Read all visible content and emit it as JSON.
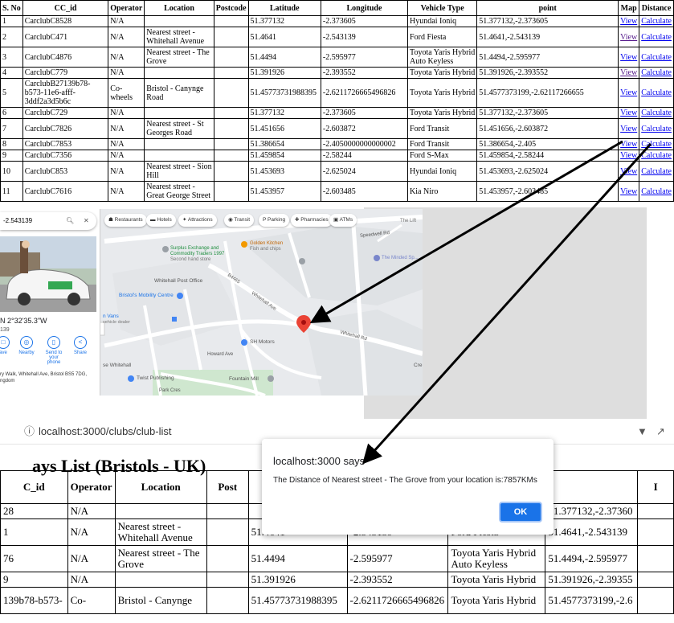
{
  "top_table": {
    "headers": [
      "S. No",
      "CC_id",
      "Operator",
      "Location",
      "Postcode",
      "Latitude",
      "Longitude",
      "Vehicle Type",
      "point",
      "Map",
      "Distance"
    ],
    "rows": [
      {
        "sno": "1",
        "cc_id": "CarclubC8528",
        "operator": "N/A",
        "location": "",
        "postcode": "",
        "lat": "51.377132",
        "lon": "-2.373605",
        "vehicle": "Hyundai Ioniq",
        "point": "51.377132,-2.373605",
        "map": "View",
        "distance": "Calculate"
      },
      {
        "sno": "2",
        "cc_id": "CarclubC471",
        "operator": "N/A",
        "location": "Nearest street - Whitehall Avenue",
        "postcode": "",
        "lat": "51.4641",
        "lon": "-2.543139",
        "vehicle": "Ford Fiesta",
        "point": "51.4641,-2.543139",
        "map": "View",
        "distance": "Calculate"
      },
      {
        "sno": "3",
        "cc_id": "CarclubC4876",
        "operator": "N/A",
        "location": "Nearest street - The Grove",
        "postcode": "",
        "lat": "51.4494",
        "lon": "-2.595977",
        "vehicle": "Toyota Yaris Hybrid Auto Keyless",
        "point": "51.4494,-2.595977",
        "map": "View",
        "distance": "Calculate"
      },
      {
        "sno": "4",
        "cc_id": "CarclubC779",
        "operator": "N/A",
        "location": "",
        "postcode": "",
        "lat": "51.391926",
        "lon": "-2.393552",
        "vehicle": "Toyota Yaris Hybrid",
        "point": "51.391926,-2.393552",
        "map": "View",
        "distance": "Calculate"
      },
      {
        "sno": "5",
        "cc_id": "CarclubB27139b78-b573-11e6-afff-3ddf2a3d5b6c",
        "operator": "Co-wheels",
        "location": "Bristol - Canynge Road",
        "postcode": "",
        "lat": "51.45773731988395",
        "lon": "-2.6211726665496826",
        "vehicle": "Toyota Yaris Hybrid",
        "point": "51.4577373199,-2.62117266655",
        "map": "View",
        "distance": "Calculate"
      },
      {
        "sno": "6",
        "cc_id": "CarclubC729",
        "operator": "N/A",
        "location": "",
        "postcode": "",
        "lat": "51.377132",
        "lon": "-2.373605",
        "vehicle": "Toyota Yaris Hybrid",
        "point": "51.377132,-2.373605",
        "map": "View",
        "distance": "Calculate"
      },
      {
        "sno": "7",
        "cc_id": "CarclubC7826",
        "operator": "N/A",
        "location": "Nearest street - St Georges Road",
        "postcode": "",
        "lat": "51.451656",
        "lon": "-2.603872",
        "vehicle": "Ford Transit",
        "point": "51.451656,-2.603872",
        "map": "View",
        "distance": "Calculate"
      },
      {
        "sno": "8",
        "cc_id": "CarclubC7853",
        "operator": "N/A",
        "location": "",
        "postcode": "",
        "lat": "51.386654",
        "lon": "-2.4050000000000002",
        "vehicle": "Ford Transit",
        "point": "51.386654,-2.405",
        "map": "View",
        "distance": "Calculate"
      },
      {
        "sno": "9",
        "cc_id": "CarclubC7356",
        "operator": "N/A",
        "location": "",
        "postcode": "",
        "lat": "51.459854",
        "lon": "-2.58244",
        "vehicle": "Ford S-Max",
        "point": "51.459854,-2.58244",
        "map": "View",
        "distance": "Calculate"
      },
      {
        "sno": "10",
        "cc_id": "CarclubC853",
        "operator": "N/A",
        "location": "Nearest street - Sion Hill",
        "postcode": "",
        "lat": "51.453693",
        "lon": "-2.625024",
        "vehicle": "Hyundai Ioniq",
        "point": "51.453693,-2.625024",
        "map": "View",
        "distance": "Calculate"
      },
      {
        "sno": "11",
        "cc_id": "CarclubC7616",
        "operator": "N/A",
        "location": "Nearest street - Great George Street",
        "postcode": "",
        "lat": "51.453957",
        "lon": "-2.603485",
        "vehicle": "Kia Niro",
        "point": "51.453957,-2.603485",
        "map": "View",
        "distance": "Calculate"
      }
    ]
  },
  "map": {
    "search_text": "-2.543139",
    "coords_text": "N 2°32'35.3\"W",
    "coords_sub": "139",
    "actions": [
      "ave",
      "Nearby",
      "Send to your phone",
      "Share"
    ],
    "address": "ry Walk, Whitehall Ave, Bristol BS5 7DG, ngdom",
    "chips": [
      "Restaurants",
      "Hotels",
      "Attractions",
      "Transit",
      "Parking",
      "Pharmacies",
      "ATMs"
    ],
    "labels": {
      "surplus": "Surplus Exchange and Commodity Traders 1997",
      "surplus_sub": "Second hand store",
      "golden": "Golden Kitchen",
      "golden_sub": "Fish and chips",
      "speedwell": "Speedwell Rd",
      "minded": "The Minded Sp...",
      "post_office": "Whitehall Post Office",
      "mobility": "Bristol's Mobility Centre",
      "b4465": "B4465",
      "whitehall_ave": "Whitehall Ave",
      "whitehall_rd": "Whitehall Rd",
      "sh_motors": "SH Motors",
      "howard": "Howard Ave",
      "fountain": "Fountain Mill",
      "twist": "Twist Publishing",
      "park_cres": "Park Cres",
      "white_hall": "se Whitehall",
      "jaguar": "n Vans",
      "jaguar_sub": "vehicle dealer",
      "the_lift": "The Lift",
      "cre": "Cre"
    }
  },
  "browser": {
    "url": "localhost:3000/clubs/club-list",
    "page_heading": "ays List (Bristols - UK)",
    "headers": [
      "C_id",
      "Operator",
      "Location",
      "Post",
      "",
      "",
      "",
      "I"
    ],
    "rows": [
      {
        "c1": "28",
        "c2": "N/A",
        "c3": "",
        "c5": "",
        "c6": "",
        "c7": "",
        "c8": "51.377132,-2.37360"
      },
      {
        "c1": "1",
        "c2": "N/A",
        "c3": "Nearest street - Whitehall Avenue",
        "c5": "51.4641",
        "c6": "-2.543139",
        "c7": "Ford Fiesta",
        "c8": "51.4641,-2.543139"
      },
      {
        "c1": "76",
        "c2": "N/A",
        "c3": "Nearest street - The Grove",
        "c5": "51.4494",
        "c6": "-2.595977",
        "c7": "Toyota Yaris Hybrid Auto Keyless",
        "c8": "51.4494,-2.595977"
      },
      {
        "c1": "9",
        "c2": "N/A",
        "c3": "",
        "c5": "51.391926",
        "c6": "-2.393552",
        "c7": "Toyota Yaris Hybrid",
        "c8": "51.391926,-2.39355"
      },
      {
        "c1": "139b78-b573-",
        "c2": "Co-",
        "c3": "Bristol - Canynge",
        "c5": "51.45773731988395",
        "c6": "-2.6211726665496826",
        "c7": "Toyota Yaris Hybrid",
        "c8": "51.4577373199,-2.6"
      }
    ]
  },
  "alert": {
    "title": "localhost:3000 says",
    "message": "The Distance of Nearest street - The Grove from your location is:7857KMs",
    "ok_label": "OK"
  },
  "colors": {
    "link": "#0000ee",
    "visited": "#551a8b",
    "arrow": "#000000",
    "pin": "#ea4335",
    "ok_button": "#1a73e8"
  }
}
